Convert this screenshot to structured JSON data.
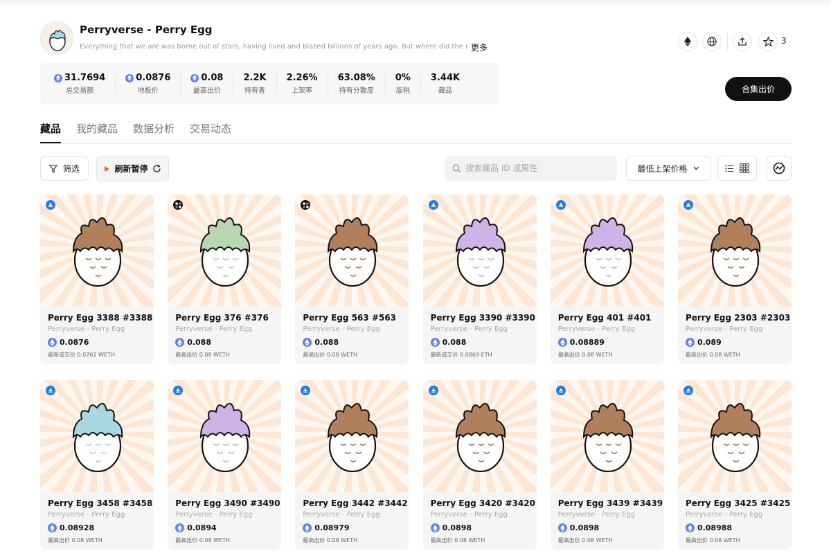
{
  "collection": {
    "name": "Perryverse - Perry Egg",
    "description": "Everything that we are was borne out of stars, having lived and blazed billions of years ago. But where did the rest of t",
    "more_label": "更多",
    "star_count": "3"
  },
  "stats": [
    {
      "value": "31.7694",
      "label": "总交易额",
      "eth": true
    },
    {
      "value": "0.0876",
      "label": "地板价",
      "eth": true
    },
    {
      "value": "0.08",
      "label": "最高出价",
      "eth": true
    },
    {
      "value": "2.2K",
      "label": "持有者",
      "eth": false
    },
    {
      "value": "2.26%",
      "label": "上架率",
      "eth": false
    },
    {
      "value": "63.08%",
      "label": "持有分散度",
      "eth": false
    },
    {
      "value": "0%",
      "label": "版税",
      "eth": false
    },
    {
      "value": "3.44K",
      "label": "藏品",
      "eth": false
    }
  ],
  "list_button": "合集出价",
  "tabs": [
    {
      "label": "藏品",
      "active": true
    },
    {
      "label": "我的藏品",
      "active": false
    },
    {
      "label": "数据分析",
      "active": false
    },
    {
      "label": "交易动态",
      "active": false
    }
  ],
  "toolbar": {
    "filter_label": "筛选",
    "refresh_label": "刷新暂停",
    "search_placeholder": "搜索藏品 ID 或属性",
    "sort_label": "最低上架价格"
  },
  "colors": {
    "brown": "#b07f5c",
    "green": "#b9d6b0",
    "purple": "#cdb3e6",
    "blue": "#a9d7e3",
    "eth": "#627eea",
    "opensea": "#2081e2"
  },
  "items": [
    {
      "name": "Perry Egg 3388 #3388",
      "collection": "Perryverse - Perry Egg",
      "price": "0.0876",
      "sub": "最新成交价 0.0761 WETH",
      "color": "brown",
      "marketplace": "opensea"
    },
    {
      "name": "Perry Egg 376 #376",
      "collection": "Perryverse - Perry Egg",
      "price": "0.088",
      "sub": "最高出价 0.08 WETH",
      "color": "green",
      "marketplace": "blur"
    },
    {
      "name": "Perry Egg 563 #563",
      "collection": "Perryverse - Perry Egg",
      "price": "0.088",
      "sub": "最高出价 0.08 WETH",
      "color": "brown",
      "marketplace": "blur"
    },
    {
      "name": "Perry Egg 3390 #3390",
      "collection": "Perryverse - Perry Egg",
      "price": "0.088",
      "sub": "最新成交价 0.0869 ETH",
      "color": "purple",
      "marketplace": "opensea"
    },
    {
      "name": "Perry Egg 401 #401",
      "collection": "Perryverse - Perry Egg",
      "price": "0.08889",
      "sub": "最高出价 0.08 WETH",
      "color": "purple",
      "marketplace": "opensea"
    },
    {
      "name": "Perry Egg 2303 #2303",
      "collection": "Perryverse - Perry Egg",
      "price": "0.089",
      "sub": "最高出价 0.08 WETH",
      "color": "brown",
      "marketplace": "opensea"
    },
    {
      "name": "Perry Egg 3458 #3458",
      "collection": "Perryverse - Perry Egg",
      "price": "0.08928",
      "sub": "最高出价 0.08 WETH",
      "color": "blue",
      "marketplace": "opensea"
    },
    {
      "name": "Perry Egg 3490 #3490",
      "collection": "Perryverse - Perry Egg",
      "price": "0.0894",
      "sub": "最高出价 0.08 WETH",
      "color": "purple",
      "marketplace": "opensea"
    },
    {
      "name": "Perry Egg 3442 #3442",
      "collection": "Perryverse - Perry Egg",
      "price": "0.08979",
      "sub": "最高出价 0.08 WETH",
      "color": "brown",
      "marketplace": "opensea"
    },
    {
      "name": "Perry Egg 3420 #3420",
      "collection": "Perryverse - Perry Egg",
      "price": "0.0898",
      "sub": "最高出价 0.08 WETH",
      "color": "brown",
      "marketplace": "opensea"
    },
    {
      "name": "Perry Egg 3439 #3439",
      "collection": "Perryverse - Perry Egg",
      "price": "0.0898",
      "sub": "最高出价 0.08 WETH",
      "color": "brown",
      "marketplace": "opensea"
    },
    {
      "name": "Perry Egg 3425 #3425",
      "collection": "Perryverse - Perry Egg",
      "price": "0.08988",
      "sub": "最高出价 0.08 WETH",
      "color": "brown",
      "marketplace": "opensea"
    }
  ]
}
